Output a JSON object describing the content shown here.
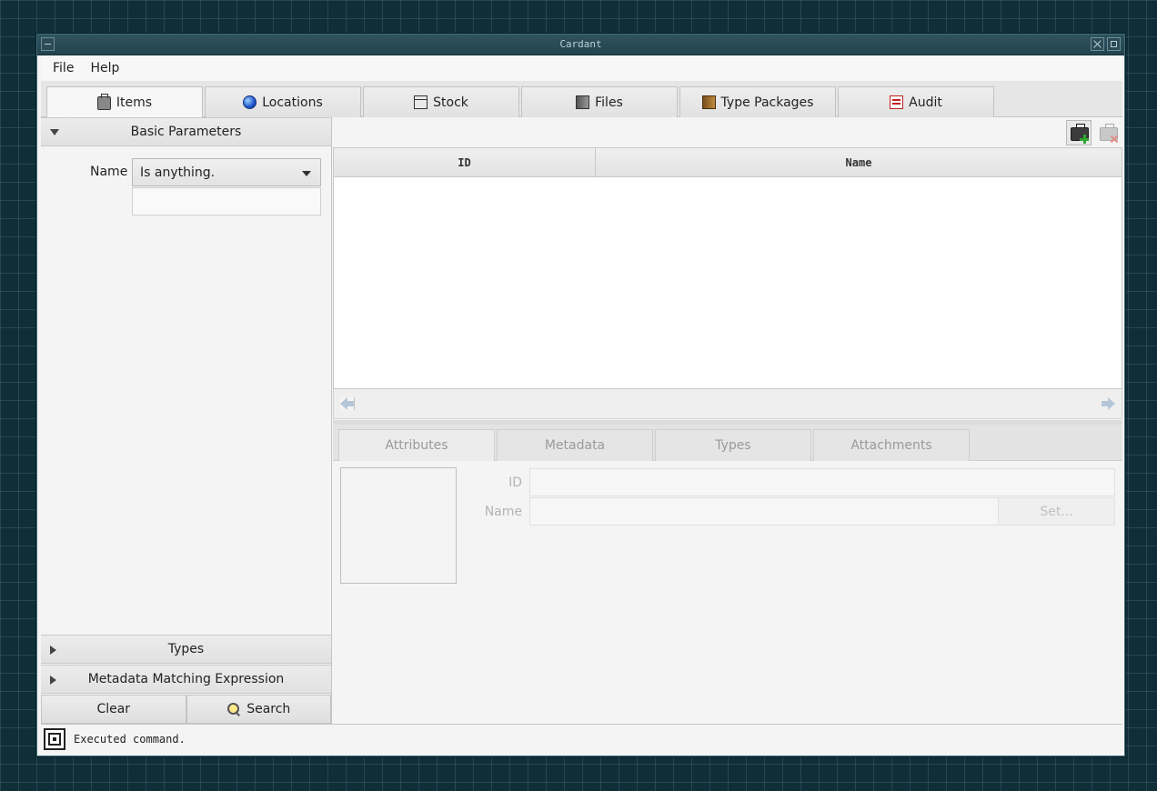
{
  "window": {
    "title": "Cardant"
  },
  "menu": {
    "file": "File",
    "help": "Help"
  },
  "tabs": [
    {
      "label": "Items",
      "icon": "briefcase-icon"
    },
    {
      "label": "Locations",
      "icon": "globe-icon"
    },
    {
      "label": "Stock",
      "icon": "box-icon"
    },
    {
      "label": "Files",
      "icon": "file-icon"
    },
    {
      "label": "Type Packages",
      "icon": "package-icon"
    },
    {
      "label": "Audit",
      "icon": "audit-log-icon"
    }
  ],
  "search": {
    "basic_header": "Basic Parameters",
    "name_label": "Name",
    "name_mode": "Is anything.",
    "name_value": "",
    "types_header": "Types",
    "metadata_header": "Metadata Matching Expression",
    "clear_label": "Clear",
    "search_label": "Search"
  },
  "table": {
    "columns": [
      "ID",
      "Name"
    ],
    "rows": []
  },
  "detail": {
    "tabs": [
      "Attributes",
      "Metadata",
      "Types",
      "Attachments"
    ],
    "id_label": "ID",
    "name_label": "Name",
    "id_value": "",
    "name_value": "",
    "set_label": "Set..."
  },
  "status": {
    "text": "Executed command."
  }
}
